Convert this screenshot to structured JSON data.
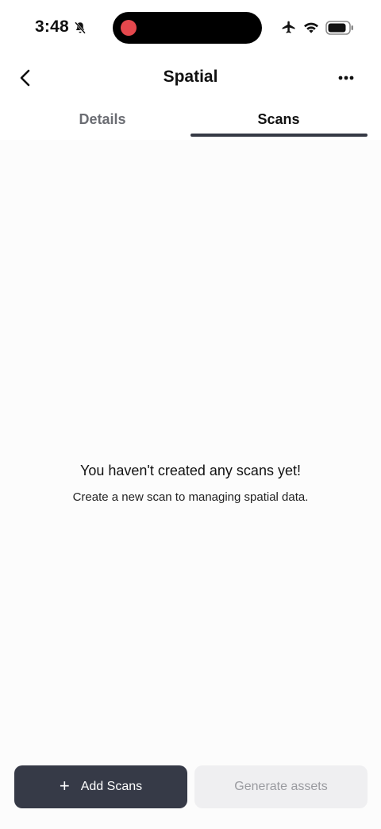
{
  "status_bar": {
    "time": "3:48",
    "icons": [
      "bell-slash-icon",
      "airplane-icon",
      "wifi-icon",
      "battery-icon"
    ],
    "recording_color": "#e5484d"
  },
  "header": {
    "title": "Spatial",
    "back_icon": "chevron-left-icon",
    "more_icon": "more-horizontal-icon"
  },
  "tabs": [
    {
      "label": "Details",
      "active": false
    },
    {
      "label": "Scans",
      "active": true
    }
  ],
  "empty_state": {
    "title": "You haven't created any scans yet!",
    "subtitle": "Create a new scan to managing spatial data."
  },
  "actions": {
    "add_label": "Add Scans",
    "add_icon": "plus-icon",
    "generate_label": "Generate assets",
    "generate_disabled": true
  },
  "colors": {
    "primary_button": "#363a47",
    "tab_indicator": "#363a45",
    "disabled_button": "#efeff1"
  }
}
